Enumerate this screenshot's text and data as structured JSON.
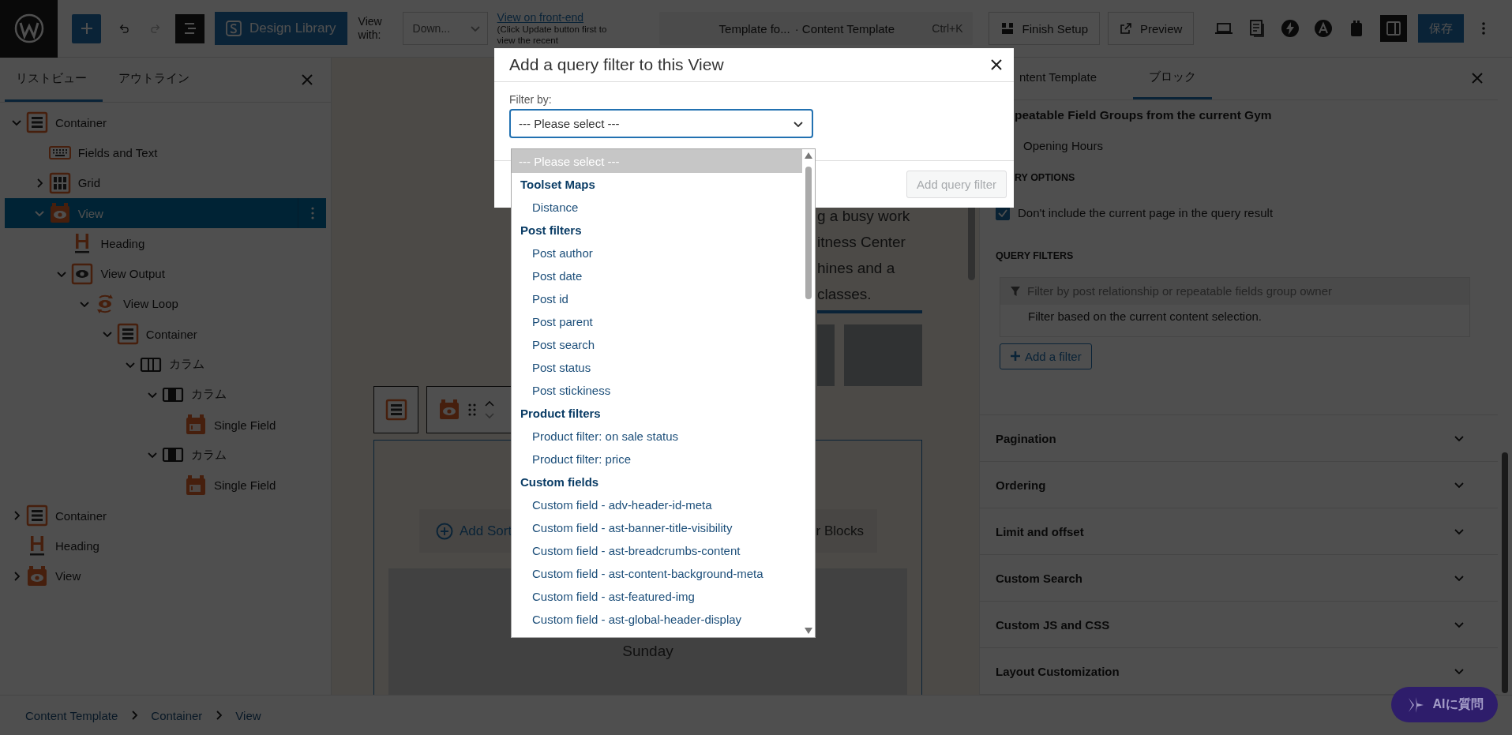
{
  "topbar": {
    "design_library_button": "Design Library",
    "view_with_label": "View with:",
    "view_select_value": "Down...",
    "front_end_link": "View on front-end",
    "front_end_note": "(Click Update button first to view the recent",
    "document_title": "Template fo...",
    "document_type": "· Content Template",
    "shortcut": "Ctrl+K",
    "finish_setup_button": "Finish Setup",
    "preview_button": "Preview",
    "sidebar_toggle": {
      "pressed": true
    },
    "save_button": "保存"
  },
  "left_panel": {
    "tabs": [
      {
        "label": "リストビュー",
        "selected": true
      },
      {
        "label": "アウトライン",
        "selected": false
      }
    ],
    "tree": [
      {
        "label": "Container",
        "kind": "container",
        "expanded": true,
        "selected": false,
        "children": [
          {
            "label": "Fields and Text",
            "kind": "fields",
            "selected": false
          },
          {
            "label": "Grid",
            "kind": "grid",
            "expanded": false,
            "selected": false
          },
          {
            "label": "View",
            "kind": "view",
            "expanded": true,
            "selected": true,
            "children": [
              {
                "label": "Heading",
                "kind": "heading",
                "selected": false
              },
              {
                "label": "View Output",
                "kind": "view-output",
                "expanded": true,
                "selected": false,
                "children": [
                  {
                    "label": "View Loop",
                    "kind": "view-loop",
                    "expanded": true,
                    "selected": false,
                    "children": [
                      {
                        "label": "Container",
                        "kind": "container",
                        "expanded": true,
                        "selected": false,
                        "children": [
                          {
                            "label": "カラム",
                            "kind": "columns",
                            "expanded": true,
                            "selected": false,
                            "children": [
                              {
                                "label": "カラム",
                                "kind": "column",
                                "expanded": true,
                                "selected": false,
                                "children": [
                                  {
                                    "label": "Single Field",
                                    "kind": "single-field",
                                    "selected": false
                                  }
                                ]
                              },
                              {
                                "label": "カラム",
                                "kind": "column",
                                "expanded": true,
                                "selected": false,
                                "children": [
                                  {
                                    "label": "Single Field",
                                    "kind": "single-field",
                                    "selected": false
                                  }
                                ]
                              }
                            ]
                          }
                        ]
                      }
                    ]
                  }
                ]
              }
            ]
          }
        ]
      },
      {
        "label": "Container",
        "kind": "container",
        "expanded": false,
        "selected": false
      },
      {
        "label": "Heading",
        "kind": "heading",
        "selected": false
      },
      {
        "label": "View",
        "kind": "view",
        "expanded": false,
        "selected": false
      }
    ]
  },
  "canvas": {
    "paragraph_lines": [
      "g a busy work",
      "itness Center",
      "hines and a",
      "classes."
    ],
    "add_sort_button": "Add Sort",
    "blocks_button": "r Blocks",
    "day_label": "Sunday"
  },
  "right_panel": {
    "tabs": [
      {
        "label": "ntent Template",
        "selected": false
      },
      {
        "label": "ブロック",
        "selected": true
      }
    ],
    "source_heading": "peatable Field Groups from the current Gym",
    "source_option": "Opening Hours",
    "options_heading": "RY OPTIONS",
    "options": [
      {
        "label": "Don't include the current page in the query result",
        "checked": true
      }
    ],
    "filters_heading": "QUERY FILTERS",
    "filter": {
      "title": "Filter by post relationship or repeatable fields group owner",
      "description": "Filter based on the current content selection."
    },
    "add_filter_button": "Add a filter",
    "sections": [
      {
        "title": "Pagination",
        "expanded": false
      },
      {
        "title": "Ordering",
        "expanded": false
      },
      {
        "title": "Limit and offset",
        "expanded": false
      },
      {
        "title": "Custom Search",
        "expanded": false
      },
      {
        "title": "Custom JS and CSS",
        "expanded": false
      },
      {
        "title": "Layout Customization",
        "expanded": false
      }
    ]
  },
  "breadcrumb": [
    "Content Template",
    "Container",
    "View"
  ],
  "ai_button": "AIに質問",
  "modal": {
    "title": "Add a query filter to this View",
    "filter_label": "Filter by:",
    "select_value": "--- Please select ---",
    "submit_button": {
      "label": "Add query filter",
      "disabled": true
    },
    "placeholder_option": {
      "label": "--- Please select ---",
      "selected": true
    },
    "groups": [
      {
        "label": "Toolset Maps",
        "options": [
          {
            "label": "Distance",
            "selected": false
          }
        ]
      },
      {
        "label": "Post filters",
        "options": [
          {
            "label": "Post author",
            "selected": false
          },
          {
            "label": "Post date",
            "selected": false
          },
          {
            "label": "Post id",
            "selected": false
          },
          {
            "label": "Post parent",
            "selected": false
          },
          {
            "label": "Post search",
            "selected": false
          },
          {
            "label": "Post status",
            "selected": false
          },
          {
            "label": "Post stickiness",
            "selected": false
          }
        ]
      },
      {
        "label": "Product filters",
        "options": [
          {
            "label": "Product filter: on sale status",
            "selected": false
          },
          {
            "label": "Product filter: price",
            "selected": false
          }
        ]
      },
      {
        "label": "Custom fields",
        "options": [
          {
            "label": "Custom field - adv-header-id-meta",
            "selected": false
          },
          {
            "label": "Custom field - ast-banner-title-visibility",
            "selected": false
          },
          {
            "label": "Custom field - ast-breadcrumbs-content",
            "selected": false
          },
          {
            "label": "Custom field - ast-content-background-meta",
            "selected": false
          },
          {
            "label": "Custom field - ast-featured-img",
            "selected": false
          },
          {
            "label": "Custom field - ast-global-header-display",
            "selected": false
          }
        ]
      }
    ]
  }
}
